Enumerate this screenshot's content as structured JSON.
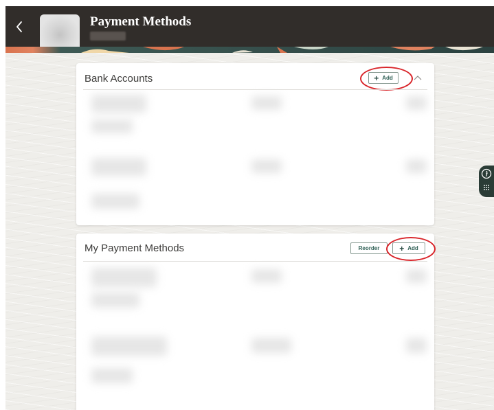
{
  "header": {
    "title": "Payment Methods",
    "back_icon": "chevron-left-icon"
  },
  "bank_accounts": {
    "title": "Bank Accounts",
    "add_label": "Add",
    "collapse_icon": "chevron-up-icon"
  },
  "my_payment_methods": {
    "title": "My Payment Methods",
    "reorder_label": "Reorder",
    "add_label": "Add"
  },
  "side_panel": {
    "icons": [
      "info-icon",
      "dots-grid-icon"
    ],
    "accent": "#2a3c36"
  },
  "colors": {
    "header_bg": "#312d2a",
    "highlight": "#d9262b",
    "button_text": "#2e5f54"
  }
}
